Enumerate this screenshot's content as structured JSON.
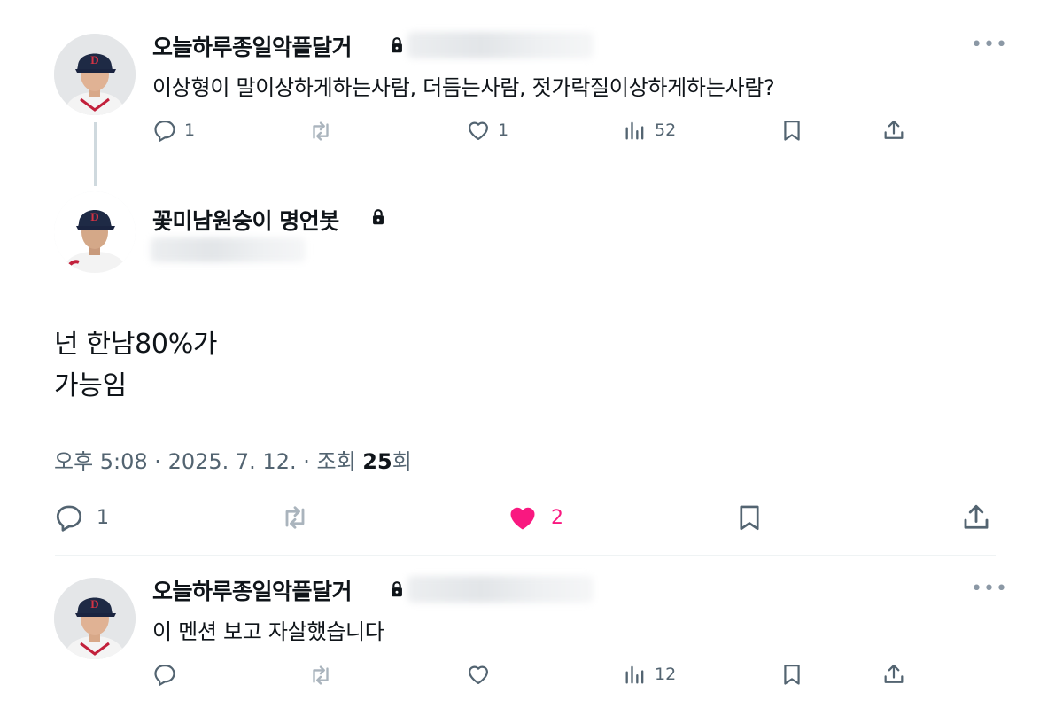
{
  "tweet1": {
    "display_name": "오늘하루종일악플달거",
    "text": "이상형이 말이상하게하는사람, 더듬는사람, 젓가락질이상하게하는사람?",
    "reply_count": "1",
    "like_count": "1",
    "view_count": "52"
  },
  "tweet2": {
    "display_name": "꽃미남원숭이 명언봇",
    "text_line1": "넌 한남80%가",
    "text_line2": "가능임",
    "time": "오후 5:08 · 2025. 7. 12. · 조회 ",
    "views": "25",
    "views_suffix": "회",
    "reply_count": "1",
    "like_count": "2"
  },
  "tweet3": {
    "display_name": "오늘하루종일악플달거",
    "text": "이 멘션 보고 자살했습니다",
    "view_count": "12"
  },
  "colors": {
    "like_active": "#f91880",
    "icon_gray": "#536471",
    "text": "#0f1419"
  },
  "icons": [
    "lock-icon",
    "reply-icon",
    "retweet-icon",
    "heart-icon",
    "views-icon",
    "bookmark-icon",
    "share-icon",
    "more-icon"
  ]
}
